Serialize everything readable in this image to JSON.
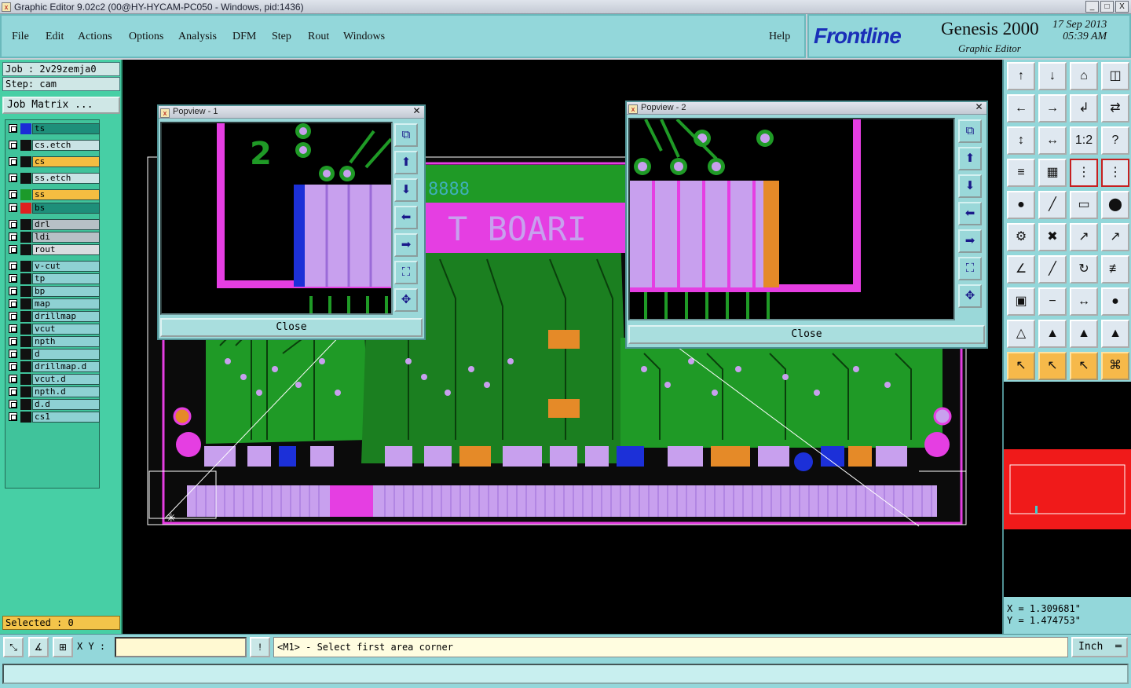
{
  "window": {
    "title": "Graphic Editor 9.02c2 (00@HY-HYCAM-PC050 - Windows, pid:1436)",
    "icon": "x-app-icon",
    "min": "_",
    "max": "□",
    "close": "X"
  },
  "menu": [
    "File",
    "Edit",
    "Actions",
    "Options",
    "Analysis",
    "DFM",
    "Step",
    "Rout",
    "Windows"
  ],
  "help": "Help",
  "brand": {
    "logo": "Frontline",
    "product": "Genesis 2000",
    "subtitle": "Graphic Editor",
    "date": "17 Sep 2013",
    "time": "05:39 AM"
  },
  "job": {
    "job_label": "Job : 2v29zemja0",
    "step_label": "Step: cam",
    "matrix_button": "Job Matrix ..."
  },
  "layers": [
    {
      "name": "ts",
      "color": "#1e8f7a",
      "swatch": "#1b2ad6"
    },
    {
      "name": "cs.etch",
      "color": "#c9e3e4",
      "swatch": "#111111"
    },
    {
      "name": "cs",
      "color": "#f4bd41",
      "swatch": "#111111"
    },
    {
      "name": "ss.etch",
      "color": "#c9e3e4",
      "swatch": "#111111"
    },
    {
      "name": "ss",
      "color": "#f4bd41",
      "swatch": "#1c9a2a"
    },
    {
      "name": "bs",
      "color": "#1e8f7a",
      "swatch": "#e02020"
    },
    {
      "name": "drl",
      "color": "#b7c0c6",
      "swatch": "#111111"
    },
    {
      "name": "ldi",
      "color": "#b7c0c6",
      "swatch": "#111111"
    },
    {
      "name": "rout",
      "color": "#d8dcdf",
      "swatch": "#111111"
    },
    {
      "name": "v-cut",
      "color": "#8ed1d3",
      "swatch": "#111111"
    },
    {
      "name": "tp",
      "color": "#8ed1d3",
      "swatch": "#111111"
    },
    {
      "name": "bp",
      "color": "#8ed1d3",
      "swatch": "#111111"
    },
    {
      "name": "map",
      "color": "#8ed1d3",
      "swatch": "#111111"
    },
    {
      "name": "drillmap",
      "color": "#8ed1d3",
      "swatch": "#111111"
    },
    {
      "name": "vcut",
      "color": "#8ed1d3",
      "swatch": "#111111"
    },
    {
      "name": "npth",
      "color": "#8ed1d3",
      "swatch": "#111111"
    },
    {
      "name": "d",
      "color": "#8ed1d3",
      "swatch": "#111111"
    },
    {
      "name": "drillmap.d",
      "color": "#8ed1d3",
      "swatch": "#111111"
    },
    {
      "name": "vcut.d",
      "color": "#8ed1d3",
      "swatch": "#111111"
    },
    {
      "name": "npth.d",
      "color": "#8ed1d3",
      "swatch": "#111111"
    },
    {
      "name": "d.d",
      "color": "#8ed1d3",
      "swatch": "#111111"
    },
    {
      "name": "cs1",
      "color": "#8ed1d3",
      "swatch": "#111111"
    }
  ],
  "selected_label": "Selected : 0",
  "board": {
    "text": "T BOARI",
    "digits": "8888",
    "left_text": "2",
    "colors": {
      "copper": "#1f9a26",
      "mask": "#e53ee2",
      "pad": "#c8a0ee",
      "blue": "#1c30d8",
      "orange": "#e58a28",
      "outline": "#ffffff"
    }
  },
  "popview1": {
    "title": "Popview - 1",
    "close": "Close"
  },
  "popview2": {
    "title": "Popview - 2",
    "close": "Close"
  },
  "coords": {
    "x": "X = 1.309681\"",
    "y": "Y = 1.474753\""
  },
  "bottom": {
    "xy_label": "X Y :",
    "xy_value": "",
    "prompt": "<M1> - Select first area corner",
    "unit": "Inch"
  },
  "tools": [
    "↑",
    "↓",
    "⌂",
    "◫",
    "←",
    "→",
    "↲",
    "⇄",
    "↕",
    "↔",
    "1:2",
    "?",
    "≡",
    "▦",
    "⋮",
    "⋮",
    "●",
    "╱",
    "▭",
    "⬤",
    "⚙",
    "✖",
    "↗",
    "↗",
    "∠",
    "╱",
    "↻",
    "≢",
    "▣",
    "−",
    "↔",
    "●",
    "△",
    "▲",
    "▲",
    "▲",
    "↖",
    "↖",
    "↖",
    "⌘"
  ]
}
